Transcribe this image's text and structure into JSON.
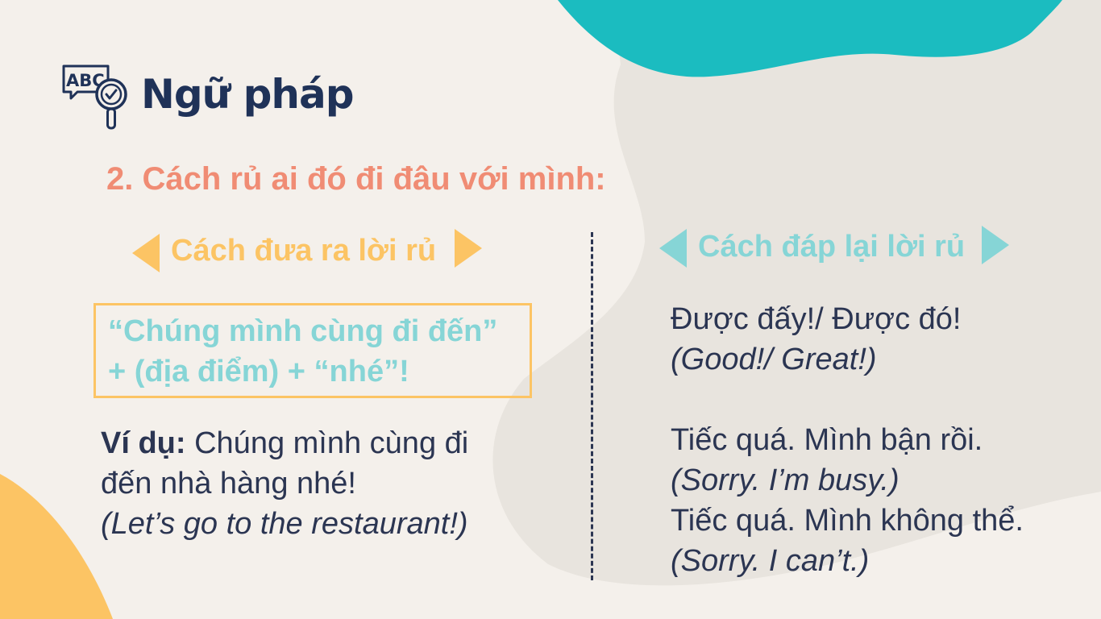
{
  "header": {
    "title": "Ngữ pháp",
    "icon_text": "ABC"
  },
  "subtitle": "2. Cách rủ ai đó đi đâu với mình:",
  "left_column": {
    "heading": "Cách đưa ra lời rủ",
    "formula_line1": "“Chúng mình cùng đi đến”",
    "formula_line2": "+ (địa điểm) + “nhé”!",
    "example_label": "Ví dụ:",
    "example_line1": " Chúng mình cùng đi",
    "example_line2": "đến nhà hàng nhé!",
    "example_translation": "(Let’s go to the restaurant!)"
  },
  "right_column": {
    "heading": "Cách đáp lại lời rủ",
    "responses": [
      {
        "text": "Được đấy!/ Được đó!",
        "translation": "(Good!/ Great!)"
      },
      {
        "text": "Tiếc quá. Mình bận rồi.",
        "translation": "(Sorry. I’m busy.)"
      },
      {
        "text": "Tiếc quá. Mình không thể.",
        "translation": "(Sorry. I can’t.)"
      }
    ]
  },
  "colors": {
    "background": "#f4f0eb",
    "title": "#1f3258",
    "subtitle": "#f08c74",
    "yellow_accent": "#fcc464",
    "teal_accent": "#86d5d6",
    "teal_blob": "#1bbcc0",
    "text": "#2b3552"
  }
}
